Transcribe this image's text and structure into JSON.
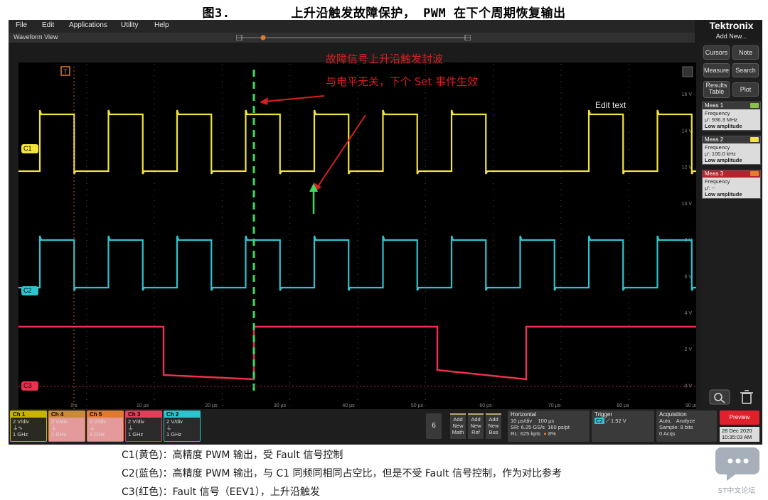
{
  "figure": {
    "title": "图3.        上升沿触发故障保护， PWM 在下个周期恢复输出"
  },
  "menu": [
    "File",
    "Edit",
    "Applications",
    "Utility",
    "Help"
  ],
  "brand": "Tektronix",
  "add_new": "Add New...",
  "view_tab": "Waveform View",
  "trigger_marker": "T",
  "channels": {
    "c1": {
      "label": "C1",
      "color": "#f2e43a"
    },
    "c2": {
      "label": "C2",
      "color": "#2ec4cf"
    },
    "c3": {
      "label": "C3",
      "color": "#f0304f"
    }
  },
  "y_ticks": [
    "16 V",
    "14 V",
    "12 V",
    "10 V",
    "8 V",
    "6 V",
    "4 V",
    "2 V",
    "0 V"
  ],
  "x_ticks": [
    "0 s",
    "10 µs",
    "20 µs",
    "30 µs",
    "40 µs",
    "50 µs",
    "60 µs",
    "70 µs",
    "80 µs",
    "90 µs"
  ],
  "annotation": {
    "line1": "故障信号上升沿触发封波",
    "line2": "与电平无关，下个 Set 事件生效"
  },
  "edit_text": "Edit text",
  "right_buttons": {
    "cursors": "Cursors",
    "note": "Note",
    "measure": "Measure",
    "search": "Search",
    "results_table_1": "Results",
    "results_table_2": "Table",
    "plot": "Plot"
  },
  "measurements": [
    {
      "title": "Meas 1",
      "type": "Frequency",
      "value": "μ': 936.3 MHz",
      "status": "Low amplitude",
      "color": "#8bc34a"
    },
    {
      "title": "Meas 2",
      "type": "Frequency",
      "value": "μ': 100.0 kHz",
      "status": "Low amplitude",
      "color": "#f2e43a"
    },
    {
      "title": "Meas 3",
      "type": "Frequency",
      "value": "μ': --",
      "status": "Low amplitude",
      "color": "#e0802a"
    }
  ],
  "channel_badges": [
    {
      "name": "Ch 1",
      "vdiv": "2 V/div",
      "bw": "1 GHz",
      "color": "#c8b400",
      "bg": "#2a2a22"
    },
    {
      "name": "Ch 4",
      "vdiv": "2 V/div",
      "bw": "1 GHz",
      "color": "#c98a3a",
      "bg": "#e49a9a"
    },
    {
      "name": "Ch 5",
      "vdiv": "2 V/div",
      "bw": "1 GHz",
      "color": "#e07a30",
      "bg": "#e49a9a"
    },
    {
      "name": "Ch 3",
      "vdiv": "2 V/div",
      "bw": "1 GHz",
      "color": "#e0405a",
      "bg": "#2a2a2a"
    },
    {
      "name": "Ch 2",
      "vdiv": "2 V/div",
      "bw": "1 GHz",
      "color": "#2ec4cf",
      "bg": "#2a2a2a"
    }
  ],
  "six": "6",
  "new_buttons": [
    {
      "l1": "Add",
      "l2": "New",
      "l3": "Math"
    },
    {
      "l1": "Add",
      "l2": "New",
      "l3": "Ref"
    },
    {
      "l1": "Add",
      "l2": "New",
      "l3": "Bus"
    }
  ],
  "horizontal": {
    "title": "Horizontal",
    "r1a": "10 µs/div",
    "r1b": "100 µs",
    "r2a": "SR: 6.25 GS/s",
    "r2b": "160 ps/pt",
    "r3a": "RL: 625 kpts",
    "r3b": "8%"
  },
  "trigger": {
    "title": "Trigger",
    "level": "1.52 V",
    "source": "C2"
  },
  "acquisition": {
    "title": "Acquisition",
    "r1a": "Auto,",
    "r1b": "Analyze",
    "r2": "Sample: 8 bits",
    "r3": "0 Acqs"
  },
  "preview": "Preview",
  "datetime": {
    "date": "28 Dec 2020",
    "time": "10:35:03 AM"
  },
  "captions": [
    "C1(黄色)：高精度 PWM 输出，受 Fault 信号控制",
    "C2(蓝色)：高精度 PWM 输出，与 C1 同频同相同占空比，但是不受 Fault 信号控制，作为对比参考",
    "C3(红色)：Fault 信号（EEV1），上升沿触发"
  ],
  "forum": "ST中文论坛"
}
